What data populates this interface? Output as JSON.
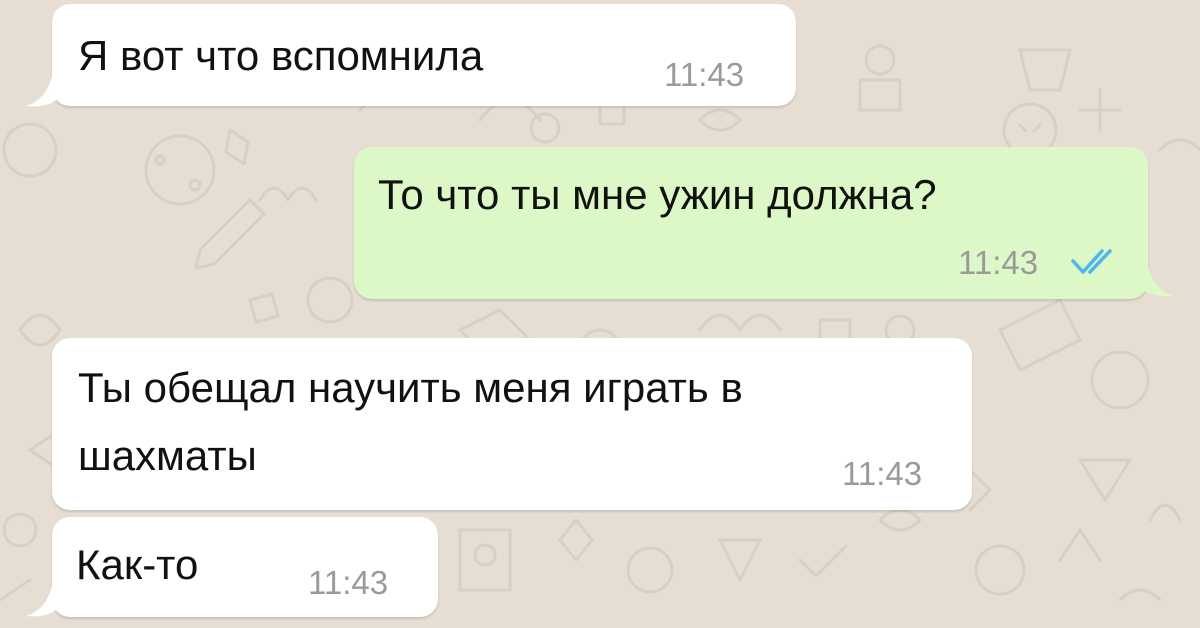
{
  "conversation": {
    "messages": [
      {
        "direction": "incoming",
        "lines": [
          "Я вот что вспомнила"
        ],
        "time": "11:43"
      },
      {
        "direction": "outgoing",
        "lines": [
          "То что ты мне ужин должна?"
        ],
        "time": "11:43",
        "status": "read"
      },
      {
        "direction": "incoming",
        "lines": [
          "Ты обещал научить меня играть в",
          "шахматы"
        ],
        "time": "11:43"
      },
      {
        "direction": "incoming",
        "lines": [
          "Как-то"
        ],
        "time": "11:43"
      }
    ]
  },
  "theme": {
    "background": "#e6ded3",
    "incoming_bubble": "#ffffff",
    "outgoing_bubble": "#dcf8c6",
    "time_color": "#9a9a9a",
    "read_ticks_color": "#4fb6ec"
  },
  "icons": {
    "read_receipt": "double-check-icon"
  }
}
